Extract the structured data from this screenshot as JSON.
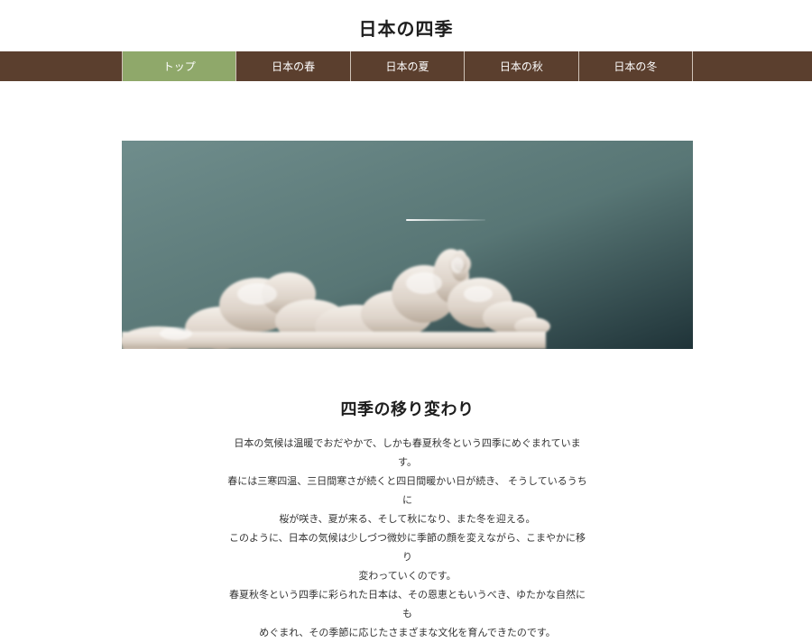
{
  "site": {
    "title": "日本の四季"
  },
  "nav": {
    "items": [
      {
        "label": "トップ"
      },
      {
        "label": "日本の春"
      },
      {
        "label": "日本の夏"
      },
      {
        "label": "日本の秋"
      },
      {
        "label": "日本の冬"
      }
    ],
    "active_index": 0
  },
  "colors": {
    "nav_background": "#5b3f2e",
    "nav_active": "#8fa86a",
    "sky": "#5f7b7d"
  },
  "hero": {
    "image_subject": "sky-with-clouds-and-airplane-contrail"
  },
  "main": {
    "heading": "四季の移り変わり",
    "paragraph_lines": [
      "日本の気候は温暖でおだやかで、しかも春夏秋冬という四季にめぐまれています。",
      "春には三寒四温、三日間寒さが続くと四日間暖かい日が続き、 そうしているうちに",
      "桜が咲き、夏が来る、そして秋になり、また冬を迎える。",
      "このように、日本の気候は少しづつ微妙に季節の顔を変えながら、こまやかに移り",
      "変わっていくのです。",
      "春夏秋冬という四季に彩られた日本は、その恩恵ともいうべき、ゆたかな自然にも",
      "めぐまれ、その季節に応じたさまざまな文化を育んできたのです。"
    ]
  }
}
